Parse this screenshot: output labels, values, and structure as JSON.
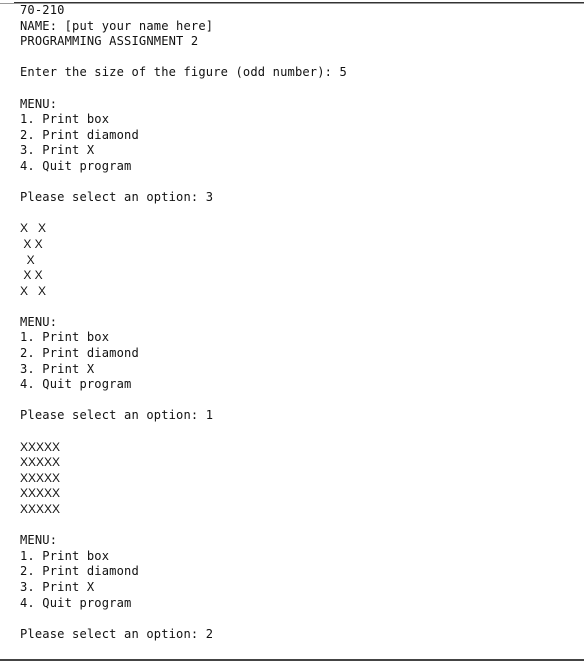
{
  "console": {
    "lines": [
      {
        "text": "70-210",
        "kind": "header"
      },
      {
        "text": "NAME: [put your name here]",
        "kind": "header"
      },
      {
        "text": "PROGRAMMING ASSIGNMENT 2",
        "kind": "header"
      },
      {
        "text": "",
        "kind": "blank"
      },
      {
        "text": "Enter the size of the figure (odd number): 5",
        "kind": "prompt"
      },
      {
        "text": "",
        "kind": "blank"
      },
      {
        "text": "MENU:",
        "kind": "menu"
      },
      {
        "text": "1. Print box",
        "kind": "menu"
      },
      {
        "text": "2. Print diamond",
        "kind": "menu"
      },
      {
        "text": "3. Print X",
        "kind": "menu"
      },
      {
        "text": "4. Quit program",
        "kind": "menu"
      },
      {
        "text": "",
        "kind": "blank"
      },
      {
        "text": "Please select an option: 3",
        "kind": "prompt"
      },
      {
        "text": "",
        "kind": "blank"
      },
      {
        "text": "X   X",
        "kind": "figure"
      },
      {
        "text": " X X",
        "kind": "figure"
      },
      {
        "text": "  X",
        "kind": "figure"
      },
      {
        "text": " X X",
        "kind": "figure"
      },
      {
        "text": "X   X",
        "kind": "figure"
      },
      {
        "text": "",
        "kind": "blank"
      },
      {
        "text": "MENU:",
        "kind": "menu"
      },
      {
        "text": "1. Print box",
        "kind": "menu"
      },
      {
        "text": "2. Print diamond",
        "kind": "menu"
      },
      {
        "text": "3. Print X",
        "kind": "menu"
      },
      {
        "text": "4. Quit program",
        "kind": "menu"
      },
      {
        "text": "",
        "kind": "blank"
      },
      {
        "text": "Please select an option: 1",
        "kind": "prompt"
      },
      {
        "text": "",
        "kind": "blank"
      },
      {
        "text": "XXXXX",
        "kind": "figure"
      },
      {
        "text": "XXXXX",
        "kind": "figure"
      },
      {
        "text": "XXXXX",
        "kind": "figure"
      },
      {
        "text": "XXXXX",
        "kind": "figure"
      },
      {
        "text": "XXXXX",
        "kind": "figure"
      },
      {
        "text": "",
        "kind": "blank"
      },
      {
        "text": "MENU:",
        "kind": "menu"
      },
      {
        "text": "1. Print box",
        "kind": "menu"
      },
      {
        "text": "2. Print diamond",
        "kind": "menu"
      },
      {
        "text": "3. Print X",
        "kind": "menu"
      },
      {
        "text": "4. Quit program",
        "kind": "menu"
      },
      {
        "text": "",
        "kind": "blank"
      },
      {
        "text": "Please select an option: 2",
        "kind": "prompt"
      }
    ]
  }
}
